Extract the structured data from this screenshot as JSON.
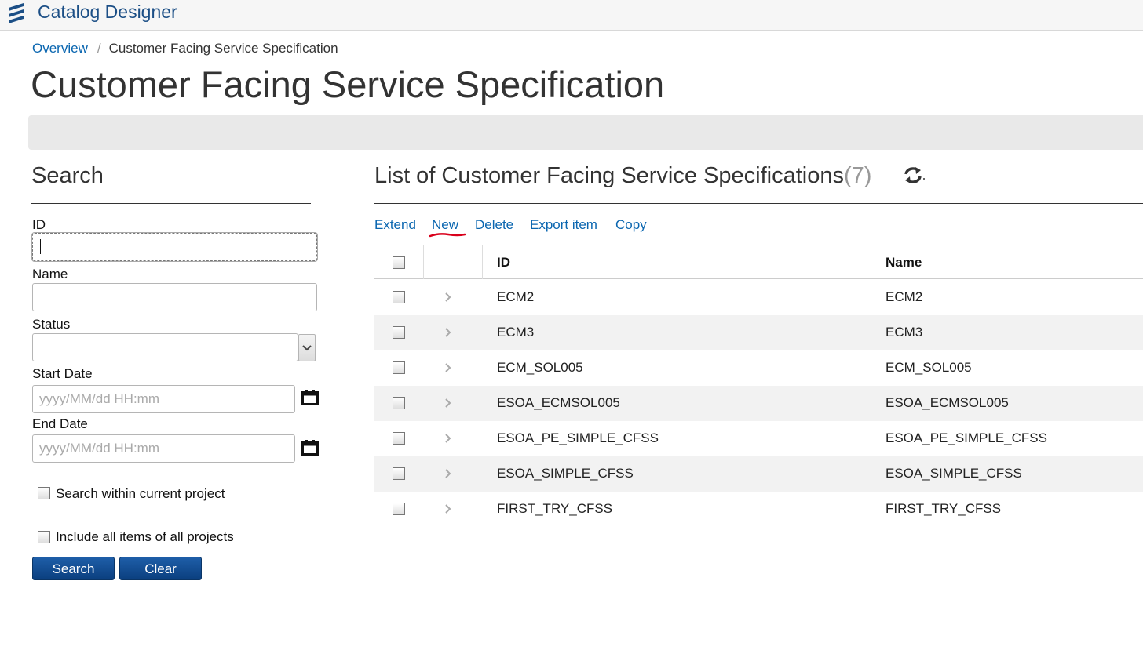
{
  "app": {
    "title": "Catalog Designer"
  },
  "breadcrumb": {
    "home": "Overview",
    "separator": "/",
    "current": "Customer Facing Service Specification"
  },
  "page": {
    "title": "Customer Facing Service Specification"
  },
  "search": {
    "heading": "Search",
    "id_label": "ID",
    "id_value": "",
    "name_label": "Name",
    "name_value": "",
    "status_label": "Status",
    "status_value": "",
    "start_label": "Start Date",
    "start_placeholder": "yyyy/MM/dd HH:mm",
    "end_label": "End Date",
    "end_placeholder": "yyyy/MM/dd HH:mm",
    "within_project_label": "Search within current project",
    "within_project_checked": false,
    "all_projects_label": "Include all items of all projects",
    "all_projects_checked": false,
    "search_button": "Search",
    "clear_button": "Clear"
  },
  "list": {
    "title": "List of Customer Facing Service Specifications",
    "count": "(7)",
    "actions": [
      "Extend",
      "New",
      "Delete",
      "Export item",
      "Copy"
    ],
    "columns": {
      "id": "ID",
      "name": "Name"
    },
    "rows": [
      {
        "id": "ECM2",
        "name": "ECM2"
      },
      {
        "id": "ECM3",
        "name": "ECM3"
      },
      {
        "id": "ECM_SOL005",
        "name": "ECM_SOL005"
      },
      {
        "id": "ESOA_ECMSOL005",
        "name": "ESOA_ECMSOL005"
      },
      {
        "id": "ESOA_PE_SIMPLE_CFSS",
        "name": "ESOA_PE_SIMPLE_CFSS"
      },
      {
        "id": "ESOA_SIMPLE_CFSS",
        "name": "ESOA_SIMPLE_CFSS"
      },
      {
        "id": "FIRST_TRY_CFSS",
        "name": "FIRST_TRY_CFSS"
      }
    ]
  },
  "colors": {
    "brand": "#1c4f86",
    "link": "#0a66b0",
    "button": "#0b3f7f",
    "annotation": "#d9001b"
  },
  "icons": {
    "logo": "ericsson-logo-icon",
    "calendar": "calendar-icon",
    "refresh": "refresh-icon",
    "row_expand": "chevron-right-icon",
    "select": "chevron-down-icon"
  }
}
